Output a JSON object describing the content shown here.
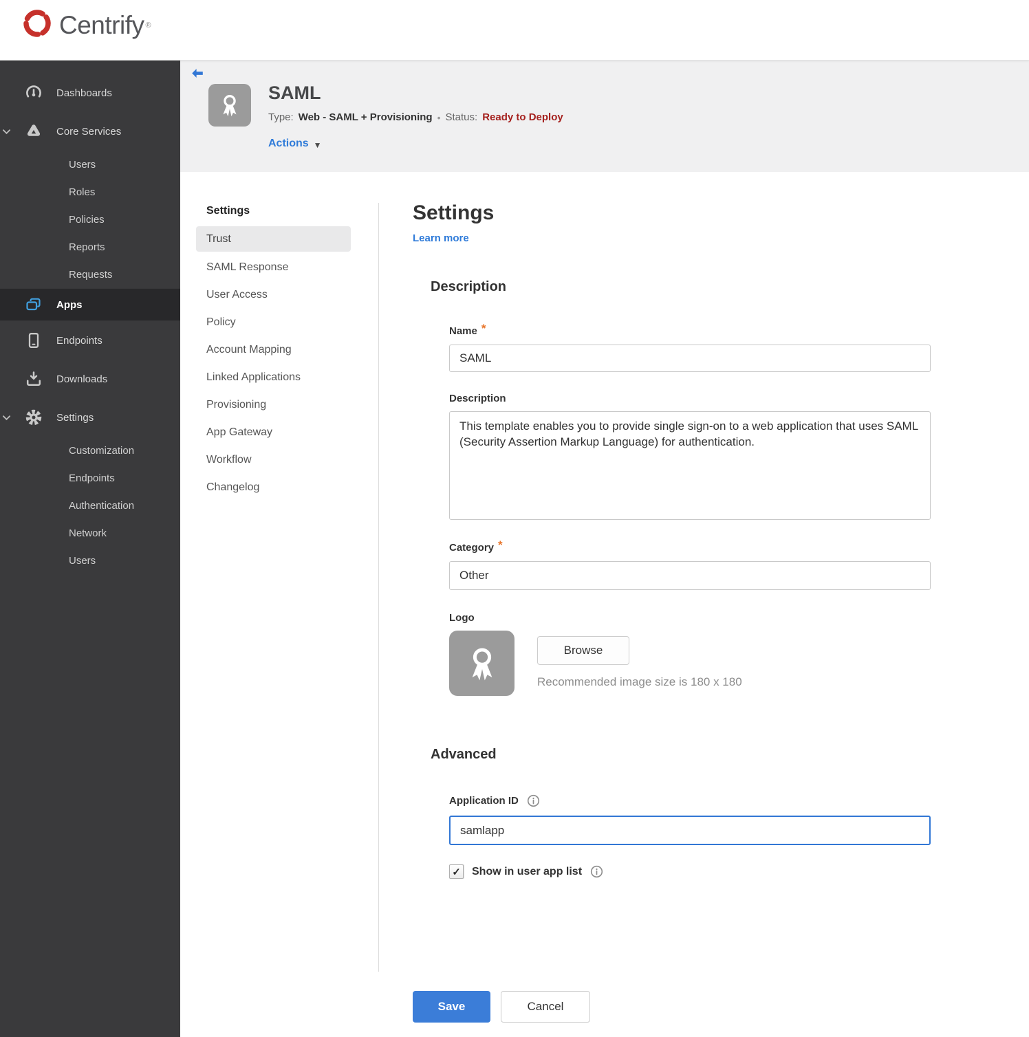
{
  "brand": {
    "name": "Centrify",
    "registered_mark": "®"
  },
  "sidebar": {
    "items": [
      {
        "label": "Dashboards",
        "icon": "gauge-icon",
        "level": 0
      },
      {
        "label": "Core Services",
        "icon": "core-services-icon",
        "level": 0,
        "expanded": true
      },
      {
        "label": "Users",
        "level": 1
      },
      {
        "label": "Roles",
        "level": 1
      },
      {
        "label": "Policies",
        "level": 1
      },
      {
        "label": "Reports",
        "level": 1
      },
      {
        "label": "Requests",
        "level": 1
      },
      {
        "label": "Apps",
        "icon": "apps-icon",
        "level": 0,
        "active": true
      },
      {
        "label": "Endpoints",
        "icon": "endpoints-icon",
        "level": 0
      },
      {
        "label": "Downloads",
        "icon": "downloads-icon",
        "level": 0
      },
      {
        "label": "Settings",
        "icon": "gear-icon",
        "level": 0,
        "expanded": true
      },
      {
        "label": "Customization",
        "level": 1
      },
      {
        "label": "Endpoints",
        "level": 1
      },
      {
        "label": "Authentication",
        "level": 1
      },
      {
        "label": "Network",
        "level": 1
      },
      {
        "label": "Users",
        "level": 1
      }
    ]
  },
  "app_header": {
    "title": "SAML",
    "type_label": "Type:",
    "type_value": "Web - SAML + Provisioning",
    "separator": "•",
    "status_label": "Status:",
    "status_value": "Ready to Deploy",
    "actions_label": "Actions"
  },
  "subnav": {
    "header": "Settings",
    "active_item": "Trust",
    "items": [
      "Trust",
      "SAML Response",
      "User Access",
      "Policy",
      "Account Mapping",
      "Linked Applications",
      "Provisioning",
      "App Gateway",
      "Workflow",
      "Changelog"
    ]
  },
  "main": {
    "title": "Settings",
    "learn_more": "Learn more",
    "required_marker": "*",
    "description_section": {
      "heading": "Description",
      "name_label": "Name",
      "name_value": "SAML",
      "description_label": "Description",
      "description_value": "This template enables you to provide single sign-on to a web application that uses SAML (Security Assertion Markup Language) for authentication.",
      "category_label": "Category",
      "category_value": "Other",
      "logo_label": "Logo",
      "browse_label": "Browse",
      "logo_hint": "Recommended image size is 180 x 180"
    },
    "advanced_section": {
      "heading": "Advanced",
      "app_id_label": "Application ID",
      "app_id_value": "samlapp",
      "show_in_app_list_label": "Show in user app list",
      "checkbox_checked": true
    },
    "footer": {
      "save_label": "Save",
      "cancel_label": "Cancel"
    }
  },
  "icons": {
    "checkmark": "✓",
    "dropdown_arrow": "▼"
  },
  "colors": {
    "accent_blue": "#2f7bd9",
    "save_blue": "#3b7dd8",
    "status_red": "#a5211e",
    "asterisk_orange": "#e8762c",
    "sidebar_bg": "#3a3a3c",
    "sidebar_active_bg": "#28282a",
    "apps_icon_blue": "#41a0e0",
    "logo_gray": "#9b9b9b",
    "header_strip_gray": "#f0f0f1"
  }
}
